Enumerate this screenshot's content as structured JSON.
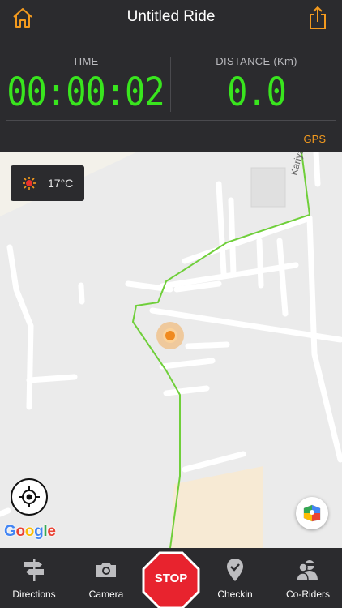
{
  "header": {
    "title": "Untitled Ride",
    "home_icon": "home-icon",
    "share_icon": "share-icon"
  },
  "stats": {
    "time_label": "TIME",
    "time_value": "00:00:02",
    "distance_label": "DISTANCE (Km)",
    "distance_value": "0.0",
    "value_color": "#39e51e"
  },
  "gps_label": "GPS",
  "gps_color": "#f39a1e",
  "map": {
    "weather": {
      "icon": "sun-icon",
      "temperature": "17°C"
    },
    "street_label": "Kariya",
    "route_color": "#6fcf3a",
    "attribution": {
      "G": "G",
      "o1": "o",
      "o2": "o",
      "g": "g",
      "l": "l",
      "e": "e"
    },
    "locate_icon": "crosshair-icon",
    "maps_icon": "google-maps-icon"
  },
  "tabbar": {
    "items": [
      {
        "label": "Directions",
        "icon": "signpost-icon"
      },
      {
        "label": "Camera",
        "icon": "camera-icon"
      },
      {
        "label": "STOP",
        "icon": "stop-octagon-icon"
      },
      {
        "label": "Checkin",
        "icon": "location-pin-icon"
      },
      {
        "label": "Co-Riders",
        "icon": "riders-icon"
      }
    ]
  }
}
